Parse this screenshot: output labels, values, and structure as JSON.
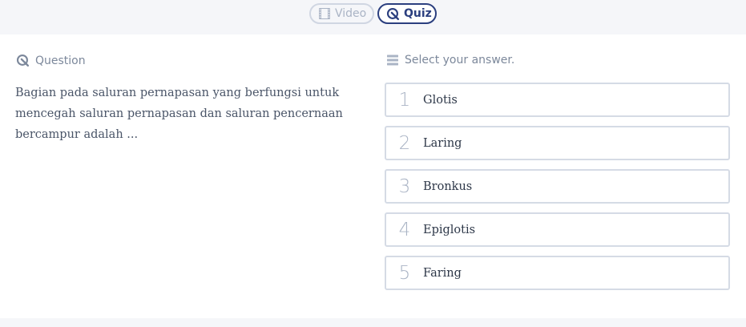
{
  "tabs": {
    "video_label": "Video",
    "quiz_label": "Quiz"
  },
  "question": {
    "header": "Question",
    "text": "Bagian pada saluran pernapasan yang berfungsi untuk mencegah saluran pernapasan dan saluran pencernaan bercampur adalah ..."
  },
  "answers": {
    "header": "Select your answer.",
    "options": [
      {
        "number": "1",
        "label": "Glotis"
      },
      {
        "number": "2",
        "label": "Laring"
      },
      {
        "number": "3",
        "label": "Bronkus"
      },
      {
        "number": "4",
        "label": "Epiglotis"
      },
      {
        "number": "5",
        "label": "Faring"
      }
    ]
  },
  "colors": {
    "accent": "#2b3f7f",
    "muted": "#aab4c5",
    "border": "#d5dbe5",
    "band": "#f5f6f9"
  },
  "icons": {
    "video": "film-icon",
    "quiz": "quiz-icon",
    "question": "quiz-icon",
    "answers": "list-icon"
  }
}
